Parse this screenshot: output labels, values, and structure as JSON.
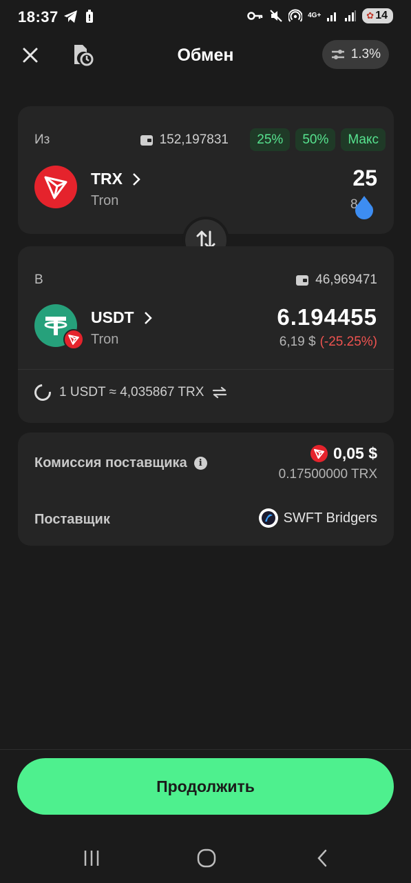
{
  "status_bar": {
    "time": "18:37",
    "network": "4G+",
    "battery": "14"
  },
  "header": {
    "title": "Обмен",
    "slippage": "1.3%"
  },
  "from": {
    "label": "Из",
    "balance": "152,197831",
    "percent_buttons": [
      "25%",
      "50%",
      "Макс"
    ],
    "token": "TRX",
    "network": "Tron",
    "amount": "25",
    "fiat": "8,2",
    "fiat_suffix": "$",
    "icon": "tron-icon",
    "color": "#e5232c"
  },
  "to": {
    "label": "В",
    "balance": "46,969471",
    "token": "USDT",
    "network": "Tron",
    "amount": "6.194455",
    "fiat": "6,19 $",
    "change": "(-25.25%)",
    "icon": "tether-icon",
    "color": "#26a17b"
  },
  "rate": {
    "text": "1 USDT ≈ 4,035867 TRX"
  },
  "fee": {
    "label": "Комиссия поставщика",
    "value": "0,05 $",
    "native": "0.17500000 TRX"
  },
  "provider": {
    "label": "Поставщик",
    "name": "SWFT Bridgers"
  },
  "continue_button": "Продолжить",
  "colors": {
    "accent": "#4ef08e",
    "background": "#1b1b1b",
    "card": "#252525",
    "negative": "#ef5350"
  }
}
